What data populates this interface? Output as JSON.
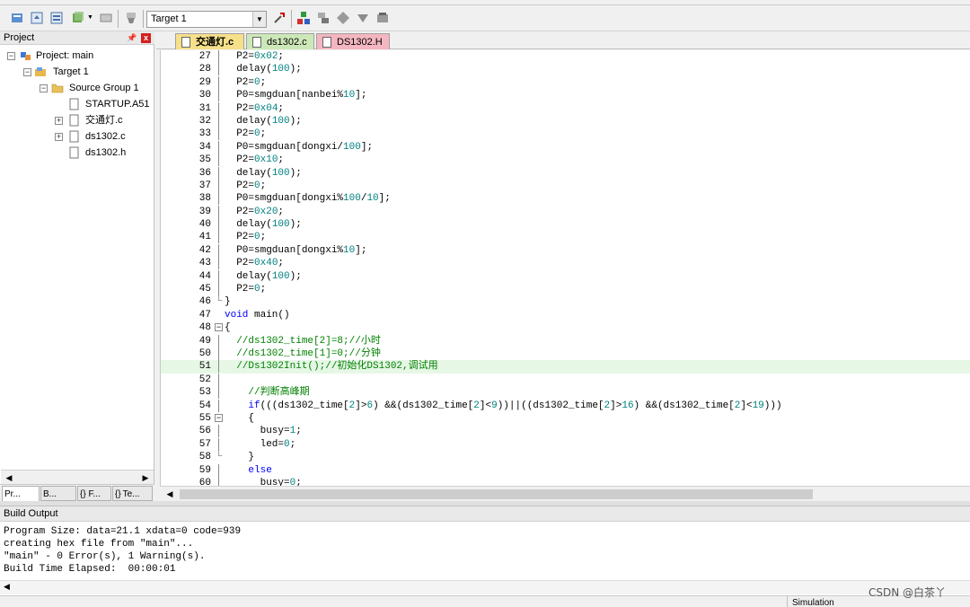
{
  "toolbar": {
    "target_select_value": "Target 1",
    "icons": [
      "translate-icon",
      "build-icon",
      "rebuild-icon",
      "batch-build-icon",
      "stop-build-icon",
      "download-icon",
      "target-select",
      "options-icon",
      "manage-components-icon",
      "pack-installer-icon",
      "select-packs-icon",
      "env-icon",
      "books-icon"
    ]
  },
  "project_panel": {
    "title": "Project",
    "pin": "р",
    "close": "x",
    "tree": [
      {
        "label": "Project: main"
      },
      {
        "label": "Target 1"
      },
      {
        "label": "Source Group 1"
      },
      {
        "label": "STARTUP.A51"
      },
      {
        "label": "交通灯.c"
      },
      {
        "label": "ds1302.c"
      },
      {
        "label": "ds1302.h"
      }
    ],
    "tabs": [
      "Pr...",
      "B...",
      "{} F...",
      "{} Te..."
    ]
  },
  "editor": {
    "tabs": [
      {
        "label": "交通灯.c",
        "color": "#f6e08a",
        "active": true
      },
      {
        "label": "ds1302.c",
        "color": "#cde8b8"
      },
      {
        "label": "DS1302.H",
        "color": "#f4b6c0"
      }
    ],
    "lines": [
      {
        "n": "27",
        "fold": "tick",
        "html": "  P2=<span class=\"num\">0x02</span>;"
      },
      {
        "n": "28",
        "fold": "tick",
        "html": "  delay(<span class=\"num\">100</span>);"
      },
      {
        "n": "29",
        "fold": "tick",
        "html": "  P2=<span class=\"num\">0</span>;"
      },
      {
        "n": "30",
        "fold": "tick",
        "html": "  P0=smgduan[nanbei%<span class=\"num\">10</span>];"
      },
      {
        "n": "31",
        "fold": "tick",
        "html": "  P2=<span class=\"num\">0x04</span>;"
      },
      {
        "n": "32",
        "fold": "tick",
        "html": "  delay(<span class=\"num\">100</span>);"
      },
      {
        "n": "33",
        "fold": "tick",
        "html": "  P2=<span class=\"num\">0</span>;"
      },
      {
        "n": "34",
        "fold": "tick",
        "html": "  P0=smgduan[dongxi/<span class=\"num\">100</span>];"
      },
      {
        "n": "35",
        "fold": "tick",
        "html": "  P2=<span class=\"num\">0x10</span>;"
      },
      {
        "n": "36",
        "fold": "tick",
        "html": "  delay(<span class=\"num\">100</span>);"
      },
      {
        "n": "37",
        "fold": "tick",
        "html": "  P2=<span class=\"num\">0</span>;"
      },
      {
        "n": "38",
        "fold": "tick",
        "html": "  P0=smgduan[dongxi%<span class=\"num\">100</span>/<span class=\"num\">10</span>];"
      },
      {
        "n": "39",
        "fold": "tick",
        "html": "  P2=<span class=\"num\">0x20</span>;"
      },
      {
        "n": "40",
        "fold": "tick",
        "html": "  delay(<span class=\"num\">100</span>);"
      },
      {
        "n": "41",
        "fold": "tick",
        "html": "  P2=<span class=\"num\">0</span>;"
      },
      {
        "n": "42",
        "fold": "tick",
        "html": "  P0=smgduan[dongxi%<span class=\"num\">10</span>];"
      },
      {
        "n": "43",
        "fold": "tick",
        "html": "  P2=<span class=\"num\">0x40</span>;"
      },
      {
        "n": "44",
        "fold": "tick",
        "html": "  delay(<span class=\"num\">100</span>);"
      },
      {
        "n": "45",
        "fold": "tick",
        "html": "  P2=<span class=\"num\">0</span>;"
      },
      {
        "n": "46",
        "fold": "end",
        "html": "}"
      },
      {
        "n": "47",
        "fold": "",
        "html": "<span class=\"kw\">void</span> main()"
      },
      {
        "n": "48",
        "fold": "box",
        "html": "{"
      },
      {
        "n": "49",
        "fold": "tick",
        "html": "  <span class=\"cm\">//ds1302_time[2]=8;//小时</span>"
      },
      {
        "n": "50",
        "fold": "tick",
        "html": "  <span class=\"cm\">//ds1302_time[1]=0;//分钟</span>"
      },
      {
        "n": "51",
        "fold": "tick",
        "hl": true,
        "html": "  <span class=\"cm\">//Ds1302Init();//初始化DS1302,调试用</span>"
      },
      {
        "n": "52",
        "fold": "tick",
        "html": ""
      },
      {
        "n": "53",
        "fold": "tick",
        "html": "    <span class=\"cm\">//判断高峰期</span>"
      },
      {
        "n": "54",
        "fold": "tick",
        "html": "    <span class=\"kw\">if</span>(((ds1302_time[<span class=\"num\">2</span>]&gt;<span class=\"num\">6</span>) &amp;&amp;(ds1302_time[<span class=\"num\">2</span>]&lt;<span class=\"num\">9</span>))||((ds1302_time[<span class=\"num\">2</span>]&gt;<span class=\"num\">16</span>) &amp;&amp;(ds1302_time[<span class=\"num\">2</span>]&lt;<span class=\"num\">19</span>)))"
      },
      {
        "n": "55",
        "fold": "box",
        "html": "    {"
      },
      {
        "n": "56",
        "fold": "tick",
        "html": "      busy=<span class=\"num\">1</span>;"
      },
      {
        "n": "57",
        "fold": "tick",
        "html": "      led=<span class=\"num\">0</span>;"
      },
      {
        "n": "58",
        "fold": "end",
        "html": "    }"
      },
      {
        "n": "59",
        "fold": "tick",
        "html": "    <span class=\"kw\">else</span>"
      },
      {
        "n": "60",
        "fold": "tick",
        "html": "      busy=<span class=\"num\">0</span>;"
      }
    ]
  },
  "build_output": {
    "title": "Build Output",
    "lines": [
      "Program Size: data=21.1 xdata=0 code=939",
      "creating hex file from \"main\"...",
      "\"main\" - 0 Error(s), 1 Warning(s).",
      "Build Time Elapsed:  00:00:01"
    ]
  },
  "status_bar": {
    "mode": "Simulation"
  },
  "watermark": "CSDN @白茶丫"
}
